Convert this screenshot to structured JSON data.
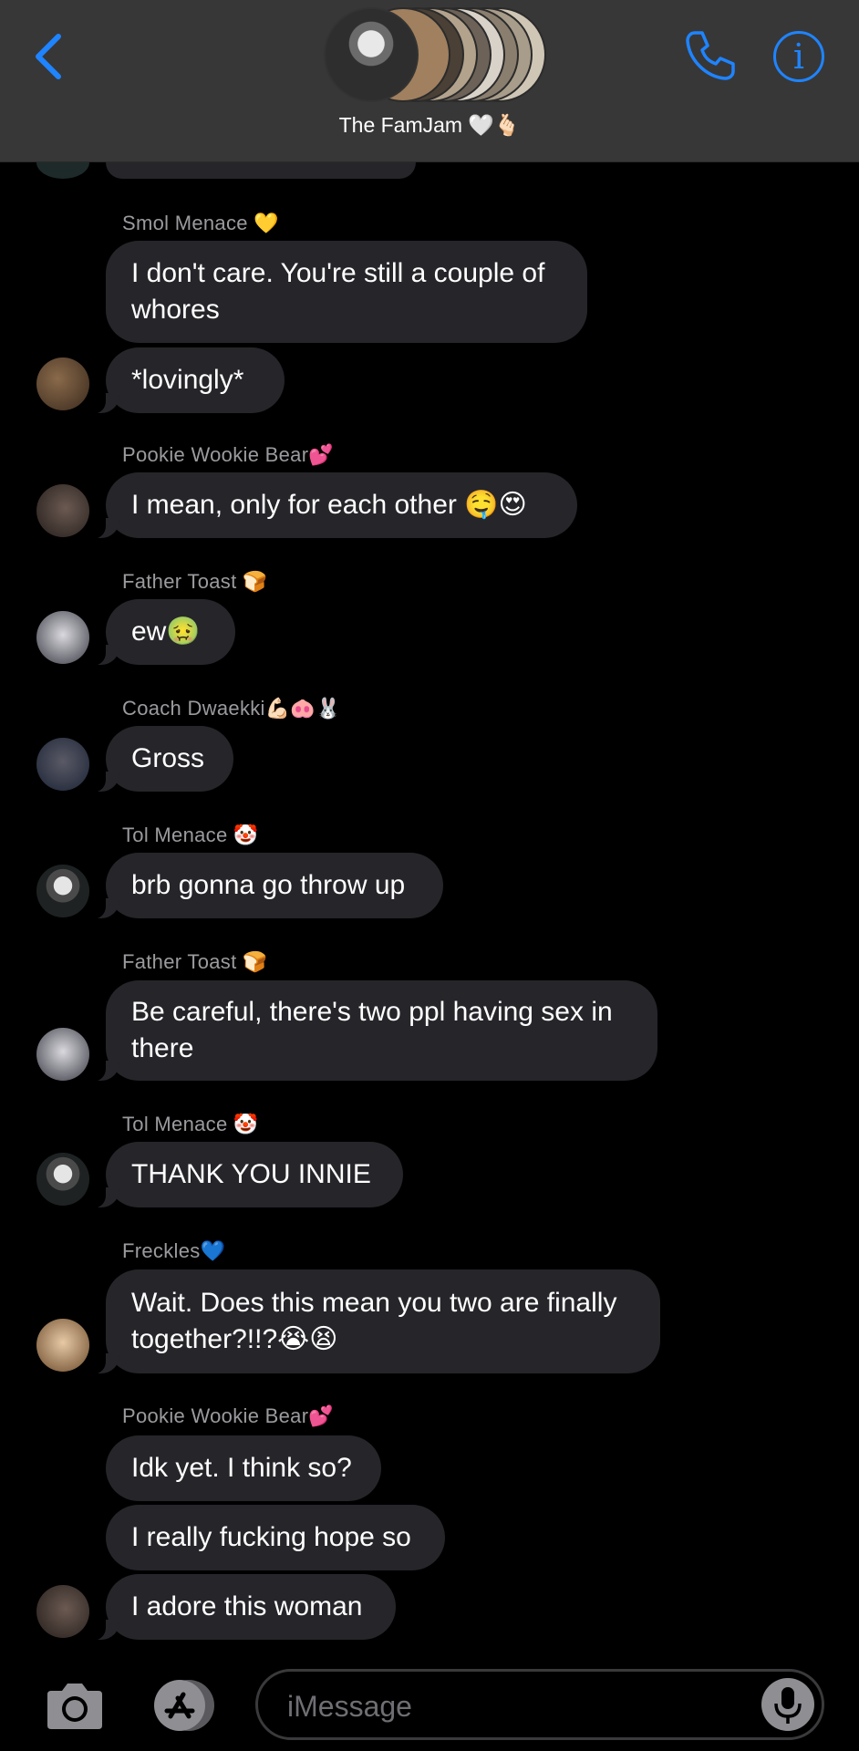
{
  "header": {
    "title": "The FamJam",
    "title_emoji": "🤍🫰🏻",
    "accent_color": "#1f84ff",
    "back_icon": "chevron-left-icon",
    "phone_icon": "phone-icon",
    "info_icon": "info-icon",
    "info_glyph": "i"
  },
  "messages": [
    {
      "sender": "Smol Menace 💛",
      "text": "I don't care. You're still a couple of whores",
      "avatar": "smol-menace"
    },
    {
      "text": "*lovingly*",
      "avatar": "smol-menace"
    },
    {
      "sender": "Pookie Wookie Bear💕",
      "text": "I mean, only for each other 🤤😍",
      "avatar": "pookie"
    },
    {
      "sender": "Father Toast 🍞",
      "text": "ew🤢",
      "avatar": "father-toast"
    },
    {
      "sender": "Coach Dwaekki💪🏻🐽🐰",
      "text": "Gross",
      "avatar": "coach"
    },
    {
      "sender": "Tol Menace 🤡",
      "text": "brb gonna go throw up",
      "avatar": "tol-menace"
    },
    {
      "sender": "Father Toast 🍞",
      "text": "Be careful, there's two ppl having sex in there",
      "avatar": "father-toast"
    },
    {
      "sender": "Tol Menace 🤡",
      "text": "THANK YOU INNIE",
      "avatar": "tol-menace"
    },
    {
      "sender": "Freckles💙",
      "text": "Wait. Does this mean you two are finally together?!!?😭😫",
      "avatar": "freckles"
    },
    {
      "sender": "Pookie Wookie Bear💕",
      "text": "Idk yet. I think so?"
    },
    {
      "text": "I really fucking hope so"
    },
    {
      "text": "I adore this woman",
      "avatar": "pookie"
    }
  ],
  "input": {
    "placeholder": "iMessage",
    "camera_icon": "camera-icon",
    "apps_icon": "app-store-icon",
    "mic_icon": "microphone-icon"
  }
}
